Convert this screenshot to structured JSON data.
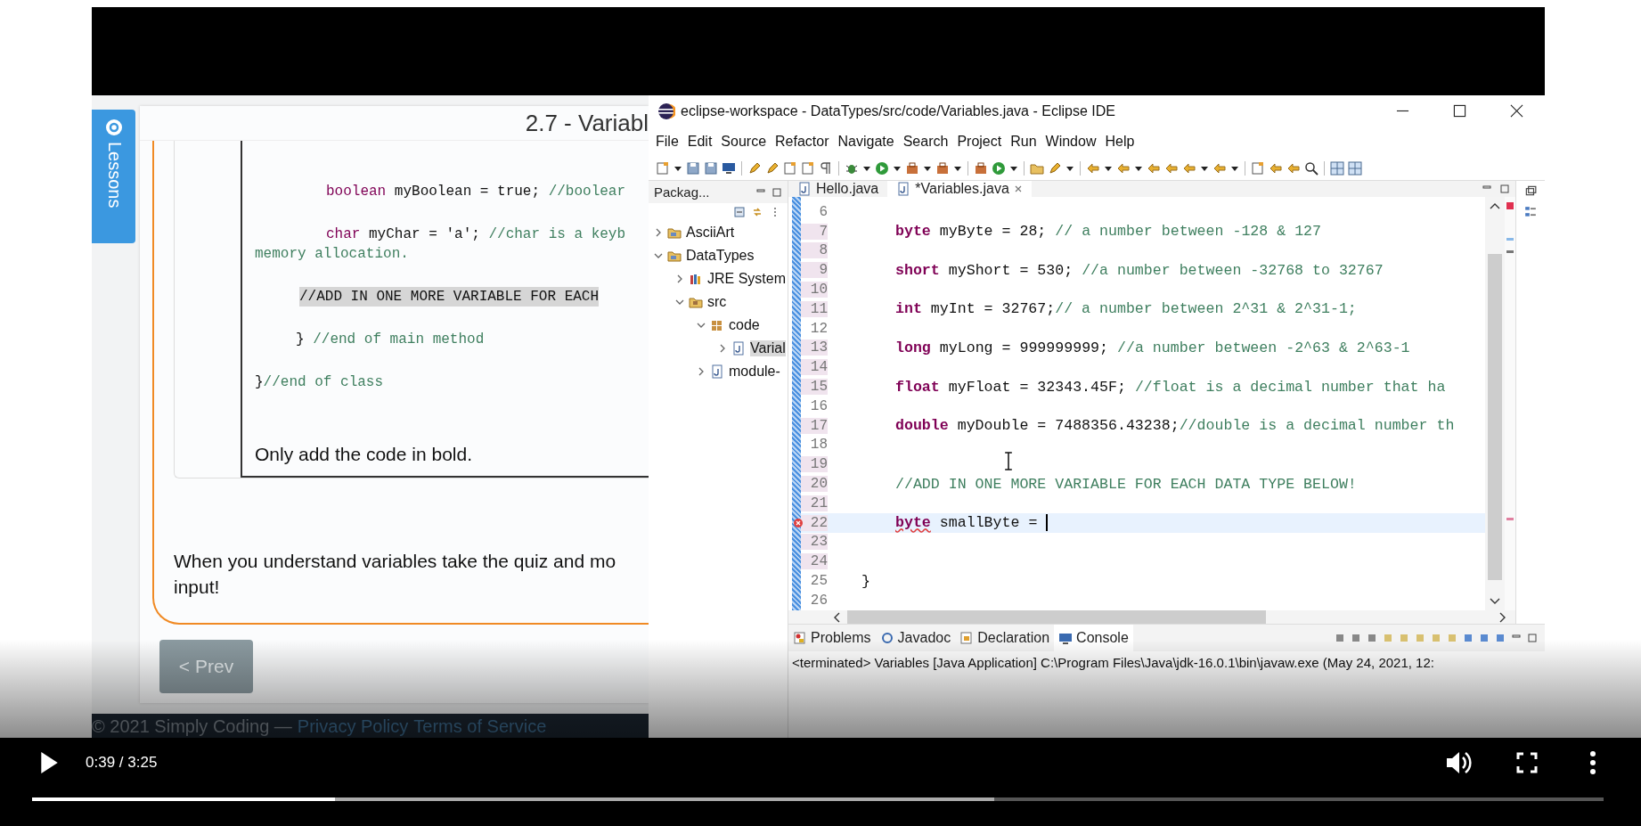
{
  "video": {
    "lesson_page": {
      "lessons_tab": "Lessons",
      "title": "2.7 - Variabl",
      "code_lines": [
        {
          "kind": "statement",
          "segments": [
            {
              "kind": "keyword",
              "text": "boolean"
            },
            {
              "kind": "code",
              "text": " myBoolean = true; "
            },
            {
              "kind": "comment",
              "text": "//boolear"
            }
          ]
        },
        {
          "kind": "statement",
          "segments": [
            {
              "kind": "keyword",
              "text": "char"
            },
            {
              "kind": "code",
              "text": " myChar = 'a'; "
            },
            {
              "kind": "comment",
              "text": "//char is a keyb"
            }
          ]
        },
        {
          "kind": "continuation",
          "segments": [
            {
              "kind": "comment",
              "text": "memory allocation."
            }
          ]
        },
        {
          "kind": "highlight",
          "segments": [
            {
              "kind": "code",
              "text": "//ADD IN ONE MORE VARIABLE FOR EACH"
            }
          ]
        },
        {
          "kind": "close",
          "segments": [
            {
              "kind": "code",
              "text": "} "
            },
            {
              "kind": "comment",
              "text": "//end of main method"
            }
          ]
        },
        {
          "kind": "class-close",
          "segments": [
            {
              "kind": "code",
              "text": "}"
            },
            {
              "kind": "comment",
              "text": "//end of class"
            }
          ]
        }
      ],
      "note": "Only add the code in bold.",
      "paragraph_lines": [
        "When you understand variables take the quiz and mo",
        "input!"
      ],
      "prev_button": "< Prev",
      "footer": {
        "copyright": "© 2021 Simply Coding  —",
        "links": [
          "Privacy Policy",
          "Terms of Service"
        ]
      }
    },
    "ide": {
      "title": "eclipse-workspace - DataTypes/src/code/Variables.java - Eclipse IDE",
      "menu": [
        "File",
        "Edit",
        "Source",
        "Refactor",
        "Navigate",
        "Search",
        "Project",
        "Run",
        "Window",
        "Help"
      ],
      "package_explorer": {
        "tab": "Packag...",
        "tree": [
          {
            "label": "AsciiArt",
            "kind": "project",
            "expanded": false,
            "selected": false
          },
          {
            "label": "DataTypes",
            "kind": "project",
            "expanded": true,
            "selected": false,
            "children": [
              {
                "label": "JRE System",
                "kind": "library",
                "expanded": false,
                "selected": false
              },
              {
                "label": "src",
                "kind": "folder",
                "expanded": true,
                "selected": false,
                "children": [
                  {
                    "label": "code",
                    "kind": "package",
                    "expanded": true,
                    "selected": false,
                    "children": [
                      {
                        "label": "Varial",
                        "kind": "file",
                        "expanded": false,
                        "selected": true
                      }
                    ]
                  },
                  {
                    "label": "module-",
                    "kind": "file",
                    "expanded": false,
                    "selected": false
                  }
                ]
              }
            ]
          }
        ]
      },
      "editor_tabs": [
        {
          "label": "Hello.java",
          "selected": false
        },
        {
          "label": "*Variables.java",
          "selected": true
        }
      ],
      "lines": [
        {
          "number": "6",
          "kind": "blank",
          "changed": false,
          "current": false,
          "error": false
        },
        {
          "number": "7",
          "kind": "body",
          "changed": true,
          "current": false,
          "error": false,
          "segments": [
            {
              "kind": "keyword",
              "text": "byte"
            },
            {
              "kind": "code",
              "text": " myByte = 28; "
            },
            {
              "kind": "comment",
              "text": "// a number between -128 & 127"
            }
          ]
        },
        {
          "number": "8",
          "kind": "blank",
          "changed": true,
          "current": false,
          "error": false
        },
        {
          "number": "9",
          "kind": "body",
          "changed": true,
          "current": false,
          "error": false,
          "segments": [
            {
              "kind": "keyword",
              "text": "short"
            },
            {
              "kind": "code",
              "text": " myShort = 530; "
            },
            {
              "kind": "comment",
              "text": "//a number between -32768 to 32767"
            }
          ]
        },
        {
          "number": "10",
          "kind": "blank",
          "changed": true,
          "current": false,
          "error": false
        },
        {
          "number": "11",
          "kind": "body",
          "changed": true,
          "current": false,
          "error": false,
          "segments": [
            {
              "kind": "keyword",
              "text": "int"
            },
            {
              "kind": "code",
              "text": " myInt = 32767;"
            },
            {
              "kind": "comment",
              "text": "// a number between 2^31 & 2^31-1;"
            }
          ]
        },
        {
          "number": "12",
          "kind": "blank",
          "changed": false,
          "current": false,
          "error": false
        },
        {
          "number": "13",
          "kind": "body",
          "changed": true,
          "current": false,
          "error": false,
          "segments": [
            {
              "kind": "keyword",
              "text": "long"
            },
            {
              "kind": "code",
              "text": " myLong = 999999999; "
            },
            {
              "kind": "comment",
              "text": "//a number between -2^63 & 2^63-1"
            }
          ]
        },
        {
          "number": "14",
          "kind": "blank",
          "changed": true,
          "current": false,
          "error": false
        },
        {
          "number": "15",
          "kind": "body",
          "changed": true,
          "current": false,
          "error": false,
          "segments": [
            {
              "kind": "keyword",
              "text": "float"
            },
            {
              "kind": "code",
              "text": " myFloat = 32343.45F; "
            },
            {
              "kind": "comment",
              "text": "//float is a decimal number that ha"
            }
          ]
        },
        {
          "number": "16",
          "kind": "blank",
          "changed": false,
          "current": false,
          "error": false
        },
        {
          "number": "17",
          "kind": "body",
          "changed": true,
          "current": false,
          "error": false,
          "segments": [
            {
              "kind": "keyword",
              "text": "double"
            },
            {
              "kind": "code",
              "text": " myDouble = 7488356.43238;"
            },
            {
              "kind": "comment",
              "text": "//double is a decimal number th"
            }
          ]
        },
        {
          "number": "18",
          "kind": "blank",
          "changed": false,
          "current": false,
          "error": false
        },
        {
          "number": "19",
          "kind": "blank",
          "changed": true,
          "current": false,
          "error": false
        },
        {
          "number": "20",
          "kind": "body",
          "changed": true,
          "current": false,
          "error": false,
          "segments": [
            {
              "kind": "comment",
              "text": "//ADD IN ONE MORE VARIABLE FOR EACH DATA TYPE BELOW!"
            }
          ]
        },
        {
          "number": "21",
          "kind": "blank",
          "changed": true,
          "current": false,
          "error": false
        },
        {
          "number": "22",
          "kind": "body",
          "changed": true,
          "current": true,
          "error": true,
          "segments": [
            {
              "kind": "keyword-error",
              "text": "byte"
            },
            {
              "kind": "code",
              "text": " smallByte = "
            }
          ]
        },
        {
          "number": "23",
          "kind": "blank",
          "changed": true,
          "current": false,
          "error": false
        },
        {
          "number": "24",
          "kind": "blank",
          "changed": true,
          "current": false,
          "error": false
        },
        {
          "number": "25",
          "kind": "close",
          "changed": false,
          "current": false,
          "error": false,
          "segments": [
            {
              "kind": "code",
              "text": "}"
            }
          ]
        },
        {
          "number": "26",
          "kind": "blank",
          "changed": false,
          "current": false,
          "error": false
        }
      ],
      "bottom_tabs": [
        {
          "label": "Problems",
          "selected": false
        },
        {
          "label": "Javadoc",
          "selected": false
        },
        {
          "label": "Declaration",
          "selected": false
        },
        {
          "label": "Console",
          "selected": true
        }
      ],
      "console_text": "<terminated> Variables [Java Application] C:\\Program Files\\Java\\jdk-16.0.1\\bin\\javaw.exe  (May 24, 2021, 12:"
    }
  },
  "player": {
    "playing": false,
    "time": "0:39 / 3:25",
    "progress": {
      "level": 0.193
    },
    "buffer": {
      "level": 0.612
    }
  }
}
